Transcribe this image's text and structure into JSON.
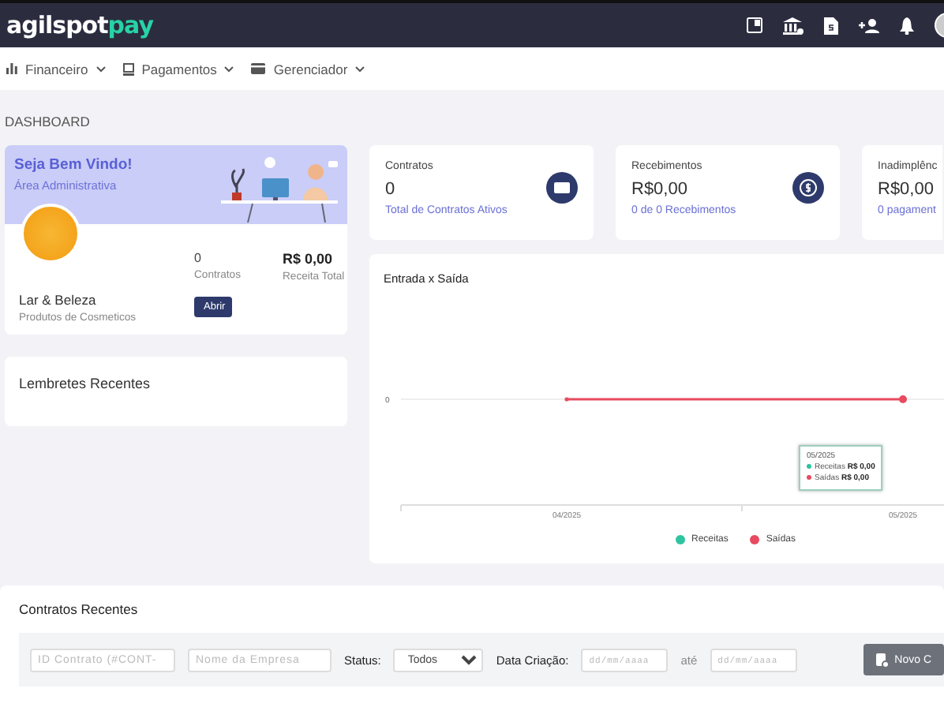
{
  "header": {
    "logo_main": "agilspot",
    "logo_accent": "pay"
  },
  "menu": [
    {
      "label": "Financeiro"
    },
    {
      "label": "Pagamentos"
    },
    {
      "label": "Gerenciador"
    }
  ],
  "page_title": "DASHBOARD",
  "welcome": {
    "title": "Seja Bem Vindo!",
    "subtitle": "Área Administrativa",
    "company": "Lar & Beleza",
    "description": "Produtos de Cosmeticos",
    "contracts_count": "0",
    "contracts_label": "Contratos",
    "revenue": "R$ 0,00",
    "revenue_label": "Receita Total",
    "button": "Abrir"
  },
  "reminders": {
    "title": "Lembretes Recentes"
  },
  "stats": [
    {
      "label": "Contratos",
      "value": "0",
      "link": "Total de Contratos Ativos"
    },
    {
      "label": "Recebimentos",
      "value": "R$0,00",
      "link": "0 de 0 Recebimentos"
    },
    {
      "label": "Inadimplênc",
      "value": "R$0,00",
      "link": "0 pagament"
    }
  ],
  "chart": {
    "title": "Entrada x Saída",
    "y_axis_label": "0",
    "x_labels": [
      "04/2025",
      "05/2025"
    ],
    "legend": [
      {
        "name": "Receitas",
        "color": "#2ec4a0"
      },
      {
        "name": "Saídas",
        "color": "#e84a5f"
      }
    ],
    "tooltip": {
      "title": "05/2025",
      "rows": [
        {
          "name": "Receitas",
          "value": "R$ 0,00"
        },
        {
          "name": "Saídas",
          "value": "R$ 0,00"
        }
      ]
    }
  },
  "recent": {
    "title": "Contratos Recentes",
    "id_placeholder": "ID Contrato (#CONT-",
    "company_placeholder": "Nome da Empresa",
    "status_label": "Status:",
    "status_value": "Todos",
    "date_label": "Data Criação:",
    "date_from_placeholder": "dd/mm/aaaa",
    "between": "até",
    "date_to_placeholder": "dd/mm/aaaa",
    "new_button": "Novo C"
  }
}
